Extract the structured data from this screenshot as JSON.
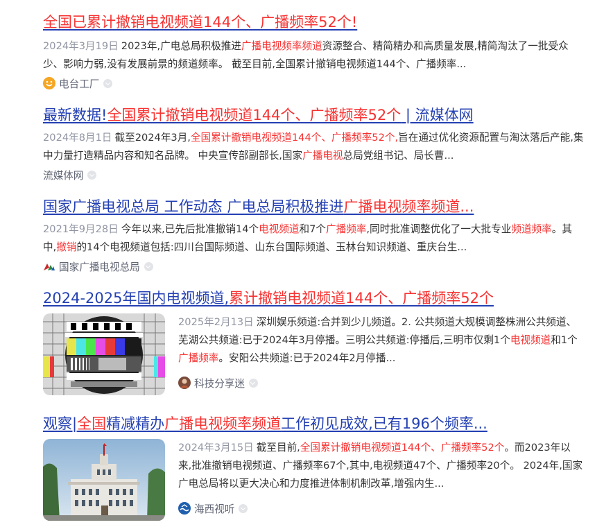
{
  "results": [
    {
      "title": [
        {
          "t": "全国已累计撤销电视频道144个、广播频率52个!",
          "hl": true
        }
      ],
      "date": "2024年3月19日",
      "snippet": [
        {
          "t": "2023年,广电总局积极推进"
        },
        {
          "t": "广播电视频率频道",
          "hl": true
        },
        {
          "t": "资源整合、精简精办和高质量发展,精简淘汰了一批受众少、影响力弱,没有发展前景的频道频率。 截至目前,全国累计撤销电视频道144个、广播频率..."
        }
      ],
      "source": "电台工厂",
      "source_icon": "smiley-logo-icon"
    },
    {
      "title": [
        {
          "t": "最新数据!"
        },
        {
          "t": "全国累计撤销电视频道144个、广播频率52个",
          "hl": true
        },
        {
          "t": " | 流媒体网"
        }
      ],
      "date": "2024年8月1日",
      "snippet": [
        {
          "t": "截至2024年3月,"
        },
        {
          "t": "全国累计撤销电视频道144个、广播频率52个,",
          "hl": true
        },
        {
          "t": "旨在通过优化资源配置与淘汰落后产能,集中力量打造精品内容和知名品牌。 中央宣传部副部长,国家"
        },
        {
          "t": "广播电视",
          "hl": true
        },
        {
          "t": "总局党组书记、局长曹..."
        }
      ],
      "source": "流媒体网",
      "source_icon": ""
    },
    {
      "title": [
        {
          "t": "国家广播电视总局 工作动态 广电总局积极推进"
        },
        {
          "t": "广播电视频率频道...",
          "hl": true
        }
      ],
      "date": "2021年9月28日",
      "snippet": [
        {
          "t": "今年以来,已先后批准撤销14个"
        },
        {
          "t": "电视频道",
          "hl": true
        },
        {
          "t": "和7个"
        },
        {
          "t": "广播频率",
          "hl": true
        },
        {
          "t": ",同时批准调整优化了一大批专业"
        },
        {
          "t": "频道频率",
          "hl": true
        },
        {
          "t": "。其中,"
        },
        {
          "t": "撤销",
          "hl": true
        },
        {
          "t": "的14个电视频道包括:四川台国际频道、山东台国际频道、玉林台知识频道、重庆台生..."
        }
      ],
      "source": "国家广播电视总局",
      "source_icon": "nrta-logo-icon"
    },
    {
      "title": [
        {
          "t": "2024-2025年国内电视频道,"
        },
        {
          "t": "累计撤销电视频道144个、广播频率52个",
          "hl": true
        }
      ],
      "date": "2025年2月13日",
      "snippet": [
        {
          "t": "深圳娱乐频道:合并到少儿频道。2. 公共频道大规模调整株洲公共频道、芜湖公共频道:已于2024年3月停播。三明公共频道:停播后,三明市仅剩1个"
        },
        {
          "t": "电视频道",
          "hl": true
        },
        {
          "t": "和1个"
        },
        {
          "t": "广播频率",
          "hl": true
        },
        {
          "t": "。安阳公共频道:已于2024年2月停播..."
        }
      ],
      "source": "科技分享迷",
      "source_icon": "avatar-icon",
      "thumb": "test-card"
    },
    {
      "title": [
        {
          "t": "观察|"
        },
        {
          "t": "全国",
          "hl": true
        },
        {
          "t": "精减精办"
        },
        {
          "t": "广播电视频率频道",
          "hl": true
        },
        {
          "t": "工作初见成效,已有196个频率..."
        }
      ],
      "date": "2024年3月15日",
      "snippet": [
        {
          "t": "截至目前,"
        },
        {
          "t": "全国累计撤销电视频道144个、广播频率52个",
          "hl": true
        },
        {
          "t": "。而2023年以来,批准撤销电视频道、广播频率67个,其中,电视频道47个、广播频率20个。 2024年,国家广电总局将以更大决心和力度推进体制机制改革,增强内生..."
        }
      ],
      "source": "海西视听",
      "source_icon": "haixi-logo-icon",
      "thumb": "building"
    }
  ],
  "colors": {
    "title": "#2440b3",
    "highlight": "#f73131",
    "date": "#9195a3",
    "text": "#333333",
    "source": "#626675"
  }
}
